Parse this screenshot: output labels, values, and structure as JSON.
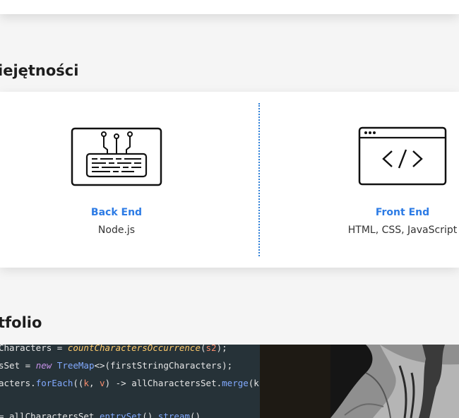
{
  "sections": {
    "skills_title": "iejętności",
    "portfolio_title": "tfolio"
  },
  "skills": [
    {
      "icon": "keyboard-icon",
      "name": "Back End",
      "tech": "Node.js"
    },
    {
      "icon": "code-window-icon",
      "name": "Front End",
      "tech": "HTML, CSS, JavaScript"
    }
  ],
  "portfolio": {
    "code_lines": [
      "Characters = countCharactersOccurrence(s2);",
      "sSet = new TreeMap<>(firstStringCharacters);",
      "acters.forEach((k, v) -> allCharactersSet.merge(k",
      "",
      "= allCharactersSet.entrySet().stream()"
    ]
  },
  "colors": {
    "accent": "#2c7be5",
    "code_background": "#263238"
  }
}
